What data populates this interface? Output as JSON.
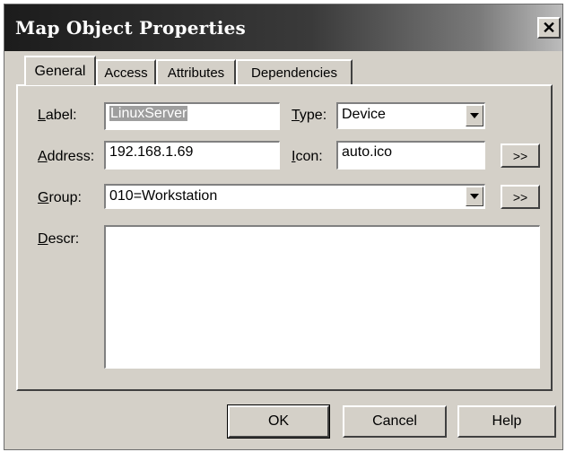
{
  "window": {
    "title": "Map Object Properties",
    "close_symbol": "✕"
  },
  "tabs": [
    {
      "label": "General",
      "active": true
    },
    {
      "label": "Access",
      "active": false
    },
    {
      "label": "Attributes",
      "active": false
    },
    {
      "label": "Dependencies",
      "active": false
    }
  ],
  "form": {
    "label": {
      "text_pre": "",
      "mnemonic": "L",
      "text_post": "abel:",
      "value": "LinuxServer"
    },
    "address": {
      "mnemonic": "A",
      "text_post": "ddress:",
      "value": "192.168.1.69"
    },
    "group": {
      "mnemonic": "G",
      "text_post": "roup:",
      "value": "010=Workstation"
    },
    "descr": {
      "mnemonic": "D",
      "text_post": "escr:",
      "value": ""
    },
    "type": {
      "mnemonic": "T",
      "text_post": "ype:",
      "value": "Device"
    },
    "icon": {
      "mnemonic": "I",
      "text_post": "con:",
      "value": "auto.ico"
    },
    "browse_label": ">>"
  },
  "buttons": {
    "ok": "OK",
    "cancel": "Cancel",
    "help": "Help"
  }
}
